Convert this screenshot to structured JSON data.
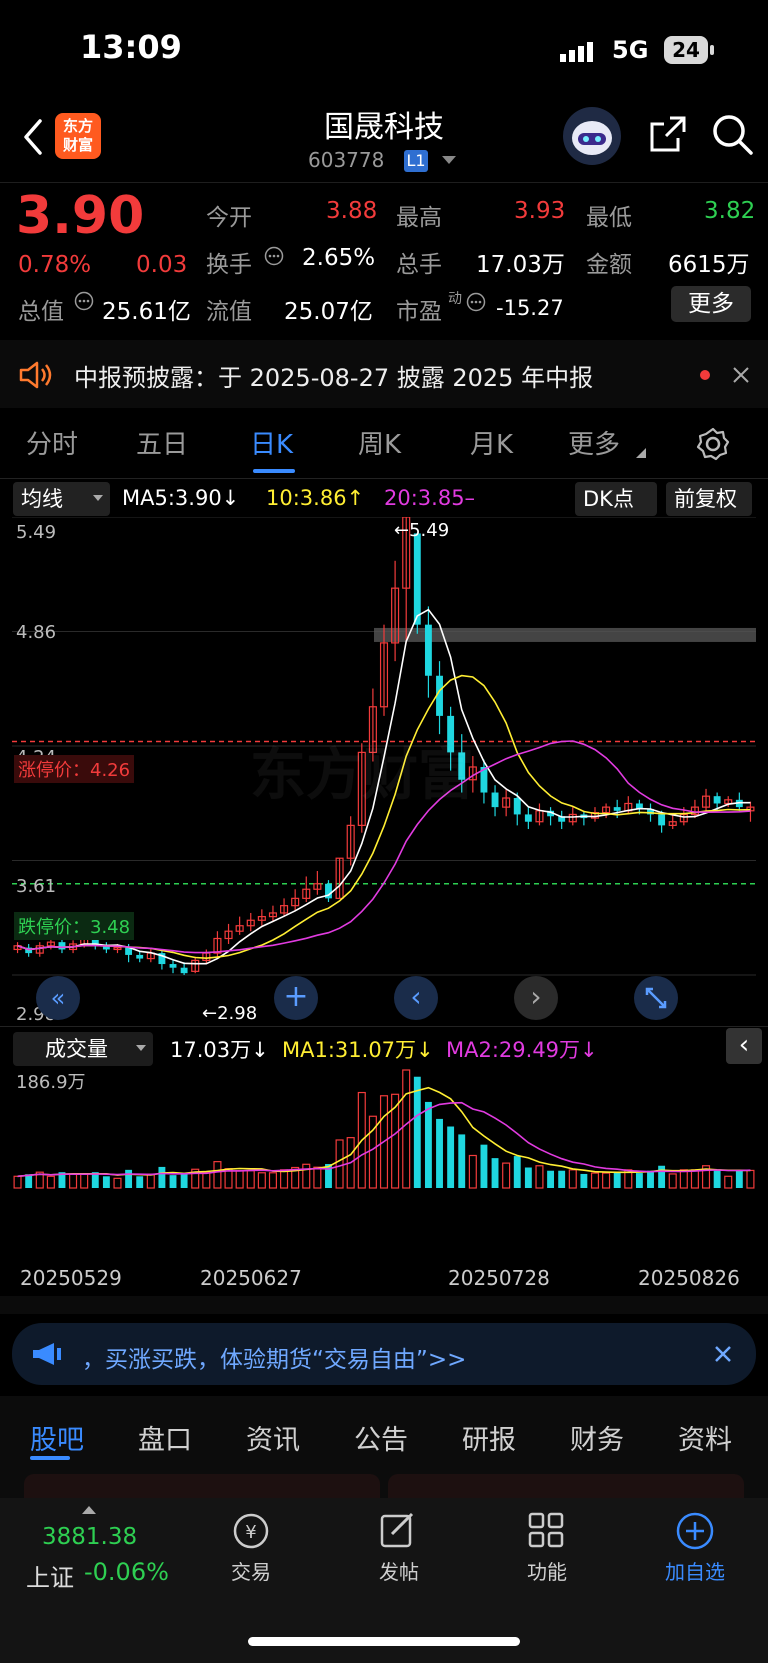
{
  "status": {
    "time": "13:09",
    "network": "5G",
    "battery": "24"
  },
  "header": {
    "logo": "东方\n财富",
    "name": "国晟科技",
    "code": "603778",
    "level": "L1"
  },
  "quote": {
    "price": "3.90",
    "change_pct": "0.78%",
    "change": "0.03",
    "open_label": "今开",
    "open": "3.88",
    "high_label": "最高",
    "high": "3.93",
    "low_label": "最低",
    "low": "3.82",
    "turnover_label": "换手",
    "turnover": "2.65%",
    "volume_label": "总手",
    "volume": "17.03万",
    "amount_label": "金额",
    "amount": "6615万",
    "mktcap_label": "总值",
    "mktcap": "25.61亿",
    "float_label": "流值",
    "float": "25.07亿",
    "pe_label": "市盈",
    "pe_sup": "动",
    "pe": "-15.27",
    "more": "更多"
  },
  "notice": {
    "text": "中报预披露：于 2025-08-27 披露 2025 年中报"
  },
  "tabs": [
    "分时",
    "五日",
    "日K",
    "周K",
    "月K",
    "更多"
  ],
  "ma_bar": {
    "select": "均线",
    "ma5": "MA5:3.90↓",
    "ma10": "10:3.86↑",
    "ma20": "20:3.85–",
    "dk": "DK点",
    "fq": "前复权"
  },
  "chart_labels": {
    "y_top": "5.49",
    "y_2": "4.86",
    "y_3": "4.24",
    "y_4": "3.61",
    "y_bot": "2.98",
    "limit_up": "涨停价：4.26",
    "limit_down": "跌停价：3.48",
    "max_mark": "5.49",
    "min_mark": "2.98",
    "watermark": "东方财富"
  },
  "vol_bar": {
    "select": "成交量",
    "vol": "17.03万↓",
    "ma1": "MA1:31.07万↓",
    "ma2": "MA2:29.49万↓",
    "vol_max": "186.9万"
  },
  "dates": [
    "20250529",
    "20250627",
    "20250728",
    "20250826"
  ],
  "ad": {
    "text": "，买涨买跌，体验期货“交易自由”>>"
  },
  "bottom_tabs": [
    "股吧",
    "盘口",
    "资讯",
    "公告",
    "研报",
    "财务",
    "资料"
  ],
  "index": {
    "value": "3881.38",
    "name": "上证",
    "change": "-0.06%"
  },
  "nav": [
    "交易",
    "发帖",
    "功能",
    "加自选"
  ],
  "colors": {
    "up": "#f23b3b",
    "down": "#2ecf52",
    "candle_down": "#1fd7e0",
    "accent": "#3a8bff"
  },
  "chart_data": {
    "type": "candlestick",
    "x_labels": [
      "20250529",
      "20250627",
      "20250728",
      "20250826"
    ],
    "y_ticks": [
      5.49,
      4.86,
      4.24,
      3.61,
      2.98
    ],
    "ylim": [
      2.98,
      5.49
    ],
    "candles": [
      [
        3.12,
        3.14,
        3.1,
        3.16
      ],
      [
        3.13,
        3.1,
        3.08,
        3.15
      ],
      [
        3.1,
        3.14,
        3.08,
        3.16
      ],
      [
        3.14,
        3.16,
        3.12,
        3.18
      ],
      [
        3.16,
        3.12,
        3.1,
        3.18
      ],
      [
        3.12,
        3.15,
        3.1,
        3.17
      ],
      [
        3.15,
        3.18,
        3.13,
        3.2
      ],
      [
        3.18,
        3.14,
        3.12,
        3.2
      ],
      [
        3.14,
        3.12,
        3.1,
        3.16
      ],
      [
        3.12,
        3.13,
        3.1,
        3.15
      ],
      [
        3.13,
        3.09,
        3.05,
        3.15
      ],
      [
        3.09,
        3.07,
        3.05,
        3.11
      ],
      [
        3.07,
        3.1,
        3.05,
        3.12
      ],
      [
        3.1,
        3.04,
        3.01,
        3.12
      ],
      [
        3.04,
        3.02,
        2.99,
        3.06
      ],
      [
        3.02,
        2.99,
        2.98,
        3.05
      ],
      [
        3.0,
        3.06,
        2.99,
        3.08
      ],
      [
        3.06,
        3.1,
        3.04,
        3.12
      ],
      [
        3.1,
        3.18,
        3.08,
        3.22
      ],
      [
        3.18,
        3.22,
        3.15,
        3.26
      ],
      [
        3.22,
        3.25,
        3.2,
        3.3
      ],
      [
        3.25,
        3.28,
        3.22,
        3.32
      ],
      [
        3.28,
        3.3,
        3.25,
        3.34
      ],
      [
        3.3,
        3.32,
        3.27,
        3.36
      ],
      [
        3.32,
        3.36,
        3.3,
        3.4
      ],
      [
        3.36,
        3.4,
        3.33,
        3.45
      ],
      [
        3.4,
        3.45,
        3.38,
        3.52
      ],
      [
        3.45,
        3.48,
        3.42,
        3.55
      ],
      [
        3.48,
        3.4,
        3.38,
        3.5
      ],
      [
        3.4,
        3.62,
        3.4,
        3.62
      ],
      [
        3.62,
        3.8,
        3.58,
        3.85
      ],
      [
        3.8,
        4.2,
        3.76,
        4.25
      ],
      [
        4.2,
        4.45,
        4.15,
        4.55
      ],
      [
        4.45,
        4.8,
        4.4,
        4.9
      ],
      [
        4.8,
        5.1,
        4.7,
        5.25
      ],
      [
        5.1,
        5.49,
        4.8,
        5.49
      ],
      [
        5.4,
        4.9,
        4.85,
        5.4
      ],
      [
        4.9,
        4.62,
        4.5,
        5.0
      ],
      [
        4.62,
        4.4,
        4.3,
        4.7
      ],
      [
        4.4,
        4.2,
        4.1,
        4.45
      ],
      [
        4.2,
        4.05,
        3.98,
        4.3
      ],
      [
        4.05,
        4.12,
        3.98,
        4.18
      ],
      [
        4.12,
        3.98,
        3.92,
        4.16
      ],
      [
        3.98,
        3.9,
        3.85,
        4.02
      ],
      [
        3.9,
        3.95,
        3.85,
        4.0
      ],
      [
        3.95,
        3.86,
        3.8,
        3.98
      ],
      [
        3.86,
        3.82,
        3.78,
        3.9
      ],
      [
        3.82,
        3.88,
        3.8,
        3.92
      ],
      [
        3.88,
        3.85,
        3.8,
        3.9
      ],
      [
        3.85,
        3.82,
        3.78,
        3.88
      ],
      [
        3.82,
        3.86,
        3.8,
        3.9
      ],
      [
        3.86,
        3.84,
        3.8,
        3.88
      ],
      [
        3.84,
        3.87,
        3.82,
        3.9
      ],
      [
        3.87,
        3.9,
        3.84,
        3.92
      ],
      [
        3.9,
        3.88,
        3.84,
        3.94
      ],
      [
        3.88,
        3.92,
        3.86,
        3.96
      ],
      [
        3.92,
        3.89,
        3.86,
        3.94
      ],
      [
        3.89,
        3.86,
        3.82,
        3.92
      ],
      [
        3.86,
        3.8,
        3.76,
        3.88
      ],
      [
        3.8,
        3.82,
        3.78,
        3.86
      ],
      [
        3.82,
        3.86,
        3.8,
        3.9
      ],
      [
        3.86,
        3.9,
        3.84,
        3.94
      ],
      [
        3.9,
        3.96,
        3.88,
        4.0
      ],
      [
        3.96,
        3.92,
        3.88,
        3.98
      ],
      [
        3.92,
        3.94,
        3.9,
        3.96
      ],
      [
        3.94,
        3.9,
        3.88,
        3.98
      ],
      [
        3.88,
        3.9,
        3.82,
        3.93
      ]
    ],
    "volume_max": "186.9万"
  }
}
